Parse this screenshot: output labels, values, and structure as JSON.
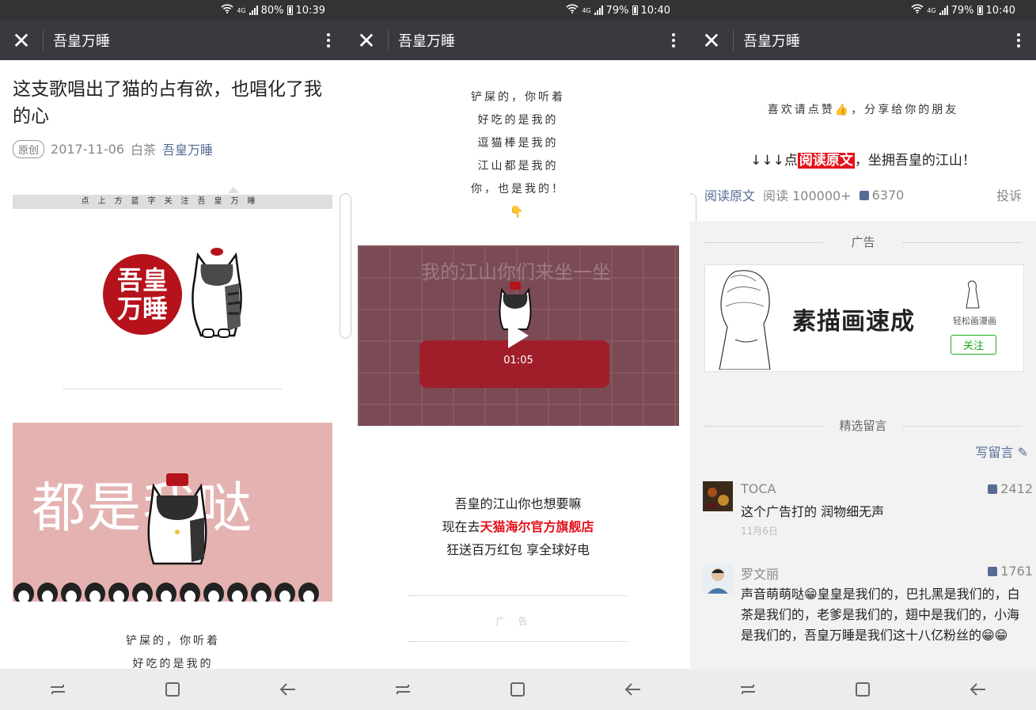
{
  "screens": [
    {
      "status": {
        "net": "4G",
        "battery": "80%",
        "time": "10:39"
      },
      "title": "吾皇万睡"
    },
    {
      "status": {
        "net": "4G",
        "battery": "79%",
        "time": "10:40"
      },
      "title": "吾皇万睡"
    },
    {
      "status": {
        "net": "4G",
        "battery": "79%",
        "time": "10:40"
      },
      "title": "吾皇万睡"
    }
  ],
  "article": {
    "title": "这支歌唱出了猫的占有欲，也唱化了我的心",
    "tag": "原创",
    "date": "2017-11-06",
    "author": "白茶",
    "account": "吾皇万睡",
    "follow_strip": "点上方蓝字关注吾皇万睡",
    "seal_text": "吾皇万睡",
    "pink_text": "都是我哒"
  },
  "poem": [
    "铲屎的，你听着",
    "好吃的是我的",
    "逗猫棒是我的",
    "江山都是我的",
    "你，也是我的！"
  ],
  "video": {
    "title": "我的江山你们来坐一坐",
    "duration": "01:05"
  },
  "promo": {
    "line1": "吾皇的江山你也想要嘛",
    "line2_prefix": "现在去",
    "line2_highlight": "天猫海尔官方旗舰店",
    "line3": "狂送百万红包 享全球好电"
  },
  "ad_label_small": "广告",
  "footer": {
    "like_line": "喜欢请点赞👍，分享给你的朋友",
    "read_prefix": "↓↓↓点",
    "read_highlight": "阅读原文",
    "read_suffix": "，坐拥吾皇的江山！",
    "read_original": "阅读原文",
    "reads": "阅读 100000+",
    "likes": "6370",
    "report": "投诉"
  },
  "ad": {
    "section_label": "广告",
    "headline": "素描画速成",
    "brand": "轻松画漫画",
    "follow": "关注"
  },
  "comments_section": {
    "label": "精选留言",
    "write": "写留言"
  },
  "comments": [
    {
      "name": "TOCA",
      "likes": "2412",
      "text": "这个广告打的 润物细无声",
      "date": "11月6日"
    },
    {
      "name": "罗文丽",
      "likes": "1761",
      "text": "声音萌萌哒😁皇皇是我们的，巴扎黑是我们的，白茶是我们的，老爹是我们的，翅中是我们的，小海是我们的，吾皇万睡是我们这十八亿粉丝的😁😁"
    }
  ]
}
